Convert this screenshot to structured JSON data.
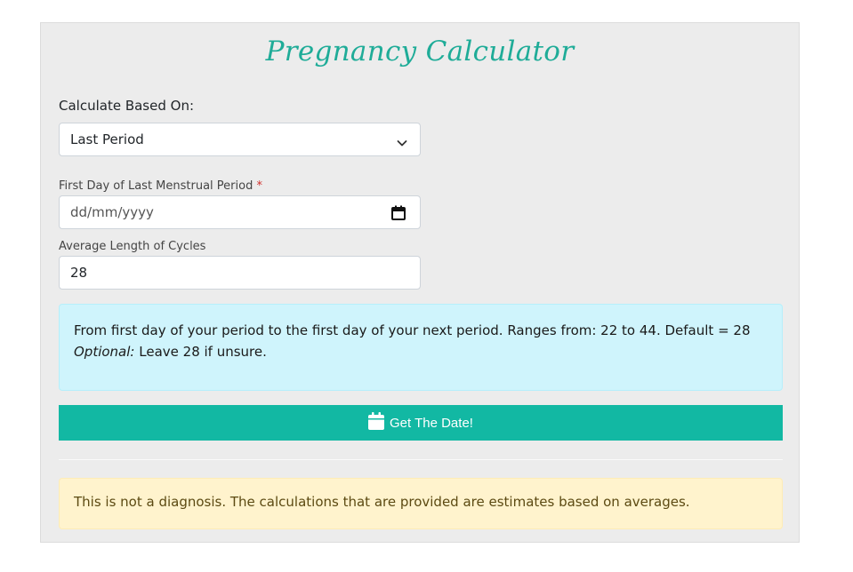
{
  "title": "Pregnancy Calculator",
  "calc_based_on": {
    "label": "Calculate Based On:",
    "selected": "Last Period"
  },
  "lmp": {
    "label": "First Day of Last Menstrual Period",
    "required_mark": "*",
    "placeholder": "dd/mm/yyyy"
  },
  "cycle": {
    "label": "Average Length of Cycles",
    "value": "28"
  },
  "info": {
    "line1": "From first day of your period to the first day of your next period. Ranges from: 22 to 44. Default = 28",
    "optional_label": "Optional:",
    "line2": "Leave 28 if unsure."
  },
  "submit_button": {
    "label": "Get The Date!",
    "icon": "calendar-icon"
  },
  "disclaimer": "This is not a diagnosis. The calculations that are provided are estimates based on averages.",
  "colors": {
    "accent": "#12b8a3",
    "title": "#1fac98",
    "info_bg": "#cff4fc",
    "warning_bg": "#fff3cd",
    "card_bg": "#ececec"
  }
}
